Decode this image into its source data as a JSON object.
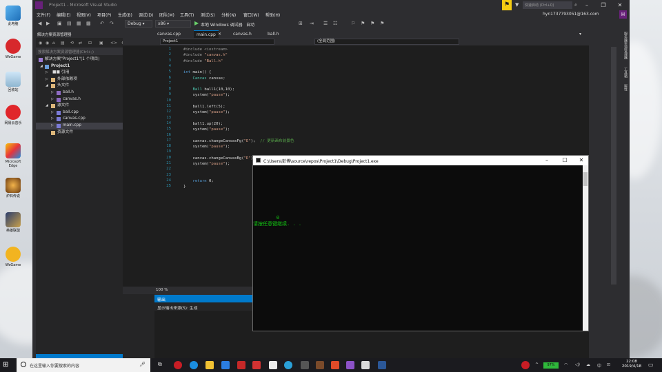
{
  "vs": {
    "window_title": "Project1 - Microsoft Visual Studio",
    "quick_launch": "快速启动 (Ctrl+Q)",
    "user": "hyn1737793051@163.com",
    "user_initial": "H",
    "menu": [
      "文件(F)",
      "编辑(E)",
      "视图(V)",
      "项目(P)",
      "生成(B)",
      "调试(D)",
      "团队(M)",
      "工具(T)",
      "测试(S)",
      "分析(N)",
      "窗口(W)",
      "帮助(H)"
    ],
    "toolbar": {
      "config": "Debug",
      "platform": "x86",
      "run_label": "本地 Windows 调试器",
      "run_mode": "自动"
    },
    "solution_explorer": {
      "header": "解决方案资源管理器",
      "search_placeholder": "搜索解决方案资源管理器(Ctrl+;)",
      "items": [
        {
          "label": "解决方案\"Project1\"(1 个项目)",
          "level": 0,
          "kind": "solution"
        },
        {
          "label": "Project1",
          "level": 1,
          "kind": "project",
          "expanded": true
        },
        {
          "label": "■■ 引用",
          "level": 2,
          "kind": "folder"
        },
        {
          "label": "外部依赖项",
          "level": 2,
          "kind": "folder"
        },
        {
          "label": "头文件",
          "level": 2,
          "kind": "folder",
          "expanded": true
        },
        {
          "label": "ball.h",
          "level": 3,
          "kind": "header"
        },
        {
          "label": "canvas.h",
          "level": 3,
          "kind": "header"
        },
        {
          "label": "源文件",
          "level": 2,
          "kind": "folder",
          "expanded": true
        },
        {
          "label": "ball.cpp",
          "level": 3,
          "kind": "cpp"
        },
        {
          "label": "canvas.cpp",
          "level": 3,
          "kind": "cpp"
        },
        {
          "label": "main.cpp",
          "level": 3,
          "kind": "cpp",
          "selected": true
        },
        {
          "label": "资源文件",
          "level": 2,
          "kind": "folder"
        }
      ]
    },
    "tabs": [
      {
        "label": "canvas.cpp",
        "active": false
      },
      {
        "label": "main.cpp",
        "active": true
      },
      {
        "label": "canvas.h",
        "active": false
      },
      {
        "label": "ball.h",
        "active": false
      }
    ],
    "nav": {
      "project": "Project1",
      "scope": "(全局范围)"
    },
    "code": [
      {
        "n": "1",
        "parts": [
          [
            "pp",
            "#include <iostream>"
          ]
        ]
      },
      {
        "n": "2",
        "parts": [
          [
            "pp",
            "#include "
          ],
          [
            "str",
            "\"canvas.h\""
          ]
        ]
      },
      {
        "n": "3",
        "parts": [
          [
            "pp",
            "#include "
          ],
          [
            "str",
            "\"Ball.h\""
          ]
        ]
      },
      {
        "n": "4",
        "parts": []
      },
      {
        "n": "5",
        "parts": [
          [
            "kw",
            "int"
          ],
          [
            "def",
            " main() {"
          ]
        ]
      },
      {
        "n": "6",
        "parts": [
          [
            "type",
            "    Canvas"
          ],
          [
            "def",
            " canvas;"
          ]
        ]
      },
      {
        "n": "7",
        "parts": []
      },
      {
        "n": "8",
        "parts": [
          [
            "type",
            "    Ball"
          ],
          [
            "def",
            " ball1(10,10);"
          ]
        ]
      },
      {
        "n": "9",
        "parts": [
          [
            "def",
            "    system("
          ],
          [
            "str",
            "\"pause\""
          ],
          [
            "def",
            ");"
          ]
        ]
      },
      {
        "n": "10",
        "parts": []
      },
      {
        "n": "11",
        "parts": [
          [
            "def",
            "    ball1.left(5);"
          ]
        ]
      },
      {
        "n": "12",
        "parts": [
          [
            "def",
            "    system("
          ],
          [
            "str",
            "\"pause\""
          ],
          [
            "def",
            ");"
          ]
        ]
      },
      {
        "n": "13",
        "parts": []
      },
      {
        "n": "14",
        "parts": [
          [
            "def",
            "    ball1.up(20);"
          ]
        ]
      },
      {
        "n": "15",
        "parts": [
          [
            "def",
            "    system("
          ],
          [
            "str",
            "\"pause\""
          ],
          [
            "def",
            ");"
          ]
        ]
      },
      {
        "n": "16",
        "parts": []
      },
      {
        "n": "17",
        "parts": [
          [
            "def",
            "    canvas.changeCanvasFg("
          ],
          [
            "str",
            "\"E\""
          ],
          [
            "def",
            ");  "
          ],
          [
            "cmt",
            "// 更新画布前景色"
          ]
        ]
      },
      {
        "n": "18",
        "parts": [
          [
            "def",
            "    system("
          ],
          [
            "str",
            "\"pause\""
          ],
          [
            "def",
            ");"
          ]
        ]
      },
      {
        "n": "19",
        "parts": []
      },
      {
        "n": "20",
        "parts": [
          [
            "def",
            "    canvas.changeCanvasBg("
          ],
          [
            "str",
            "\"D\""
          ],
          [
            "def",
            ");  "
          ],
          [
            "cmt",
            "// 更新画布背景色"
          ]
        ]
      },
      {
        "n": "21",
        "parts": [
          [
            "def",
            "    system("
          ],
          [
            "str",
            "\"pause\""
          ],
          [
            "def",
            ");"
          ]
        ]
      },
      {
        "n": "22",
        "parts": []
      },
      {
        "n": "23",
        "parts": []
      },
      {
        "n": "24",
        "parts": [
          [
            "kw",
            "    return"
          ],
          [
            "def",
            " 0;"
          ]
        ]
      },
      {
        "n": "25",
        "parts": [
          [
            "def",
            "}"
          ]
        ]
      }
    ],
    "zoom": "100 %",
    "output": {
      "header": "输出",
      "source_label": "显示输出来源(S): 生成"
    },
    "right_tabs": [
      "服务器资源管理器",
      "工具箱",
      "属性"
    ]
  },
  "console": {
    "title": "C:\\Users\\彭博\\source\\repos\\Project1\\Debug\\Project1.exe",
    "lines": [
      "        0",
      "请按任意键继续. . ."
    ]
  },
  "desktop": {
    "icons": [
      "此电脑",
      "WeGame",
      "回收站",
      "网易云音乐",
      "Microsoft Edge",
      "炉石传说",
      "英雄联盟",
      "WeGame"
    ]
  },
  "taskbar": {
    "search_placeholder": "在这里输入你要搜索的内容",
    "battery": "97%",
    "time": "22:08",
    "date": "2019/4/18"
  }
}
